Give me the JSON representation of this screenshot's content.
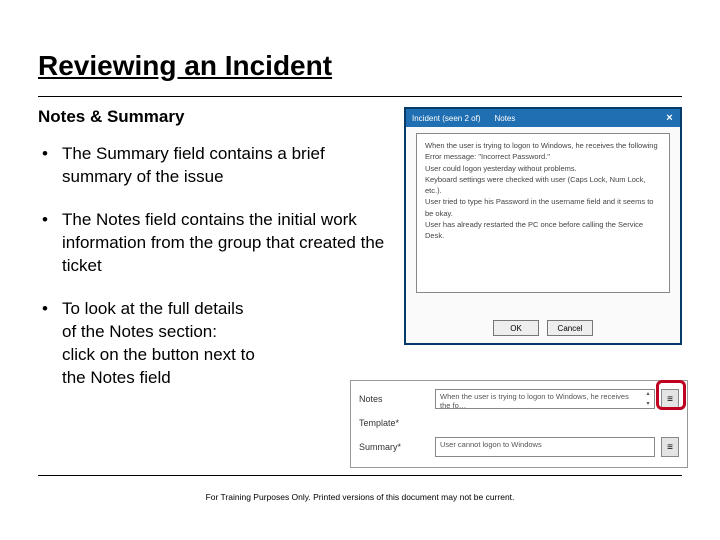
{
  "title": "Reviewing an Incident",
  "subhead": "Notes & Summary",
  "bullets": {
    "b1": "The Summary field contains a brief summary of the issue",
    "b2": "The Notes field contains the initial work information from the group that created the ticket",
    "b3": "To look at the full details of the Notes section:\nclick on the button next to the Notes field"
  },
  "dialog": {
    "title_left": "Incident (seen 2 of)",
    "title_right": "Notes",
    "close": "×",
    "body_lines": "When the user is trying to logon to Windows, he receives the following Error message: \"Incorrect Password.\"\nUser could logon yesterday without problems.\nKeyboard settings were checked with user (Caps Lock, Num Lock, etc.).\nUser tried to type his Password in the username field and it seems to be okay.\nUser has already restarted the PC once before calling the Service Desk.",
    "ok": "OK",
    "cancel": "Cancel"
  },
  "form": {
    "notes_label": "Notes",
    "notes_value": "When the user is trying to logon to Windows, he receives the fo…",
    "template_label": "Template*",
    "summary_label": "Summary*",
    "summary_value": "User cannot logon to Windows",
    "expand_icon": "≡"
  },
  "footer": "For Training Purposes Only. Printed versions of this document may not be current."
}
